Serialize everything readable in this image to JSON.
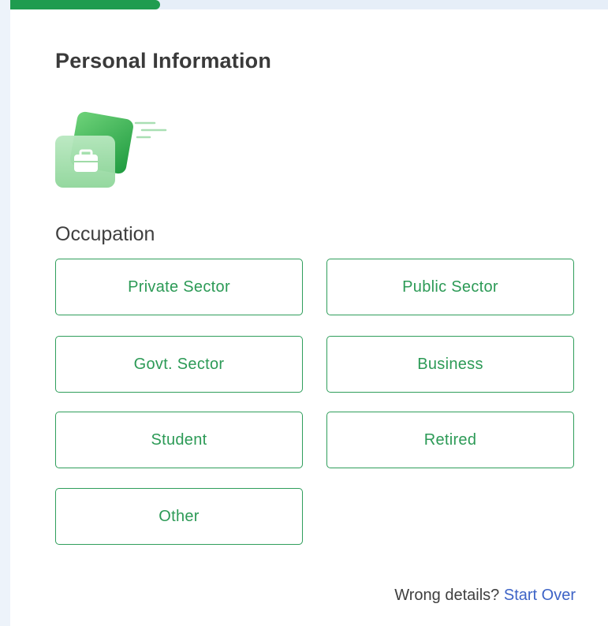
{
  "progress": {
    "fraction": 0.25,
    "color": "#1f9c4f"
  },
  "header": {
    "title": "Personal Information"
  },
  "illustration": {
    "icon": "briefcase-card-icon"
  },
  "occupation": {
    "label": "Occupation",
    "options": [
      {
        "label": "Private Sector"
      },
      {
        "label": "Public Sector"
      },
      {
        "label": "Govt. Sector"
      },
      {
        "label": "Business"
      },
      {
        "label": "Student"
      },
      {
        "label": "Retired"
      },
      {
        "label": "Other"
      }
    ]
  },
  "footer": {
    "prompt": "Wrong details?",
    "link": "Start Over"
  },
  "colors": {
    "accent": "#2c9a56",
    "link": "#3d63c6"
  }
}
